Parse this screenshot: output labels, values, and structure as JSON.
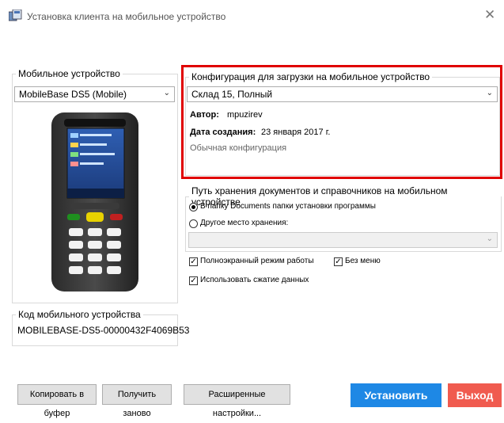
{
  "window": {
    "title": "Установка клиента на мобильное устройство",
    "close_glyph": "✕"
  },
  "device": {
    "legend": "Мобильное устройство",
    "selected": "MobileBase DS5 (Mobile)"
  },
  "device_code": {
    "legend": "Код мобильного устройства",
    "value": "MOBILEBASE-DS5-00000432F4069B53"
  },
  "config": {
    "legend": "Конфигурация для загрузки на мобильное устройство",
    "selected": "Склад 15, Полный",
    "author_label": "Автор:",
    "author": "mpuzirev",
    "date_label": "Дата создания:",
    "date": "23 января 2017 г.",
    "description": "Обычная конфигурация",
    "highlight_color": "#e00000"
  },
  "storage": {
    "legend": "Путь хранения документов и справочников на мобильном устройстве",
    "option_documents": "В папку Documents папки установки программы",
    "option_other": "Другое место хранения:",
    "selected": "documents"
  },
  "options": {
    "fullscreen": "Полноэкранный режим работы",
    "fullscreen_checked": true,
    "no_menu": "Без меню",
    "no_menu_checked": true,
    "compression": "Использовать сжатие данных",
    "compression_checked": true
  },
  "buttons": {
    "copy": "Копировать в буфер",
    "refresh": "Получить заново",
    "advanced": "Расширенные настройки...",
    "install": "Установить",
    "exit": "Выход"
  },
  "colors": {
    "install": "#1e88e5",
    "exit": "#f05b4f"
  }
}
